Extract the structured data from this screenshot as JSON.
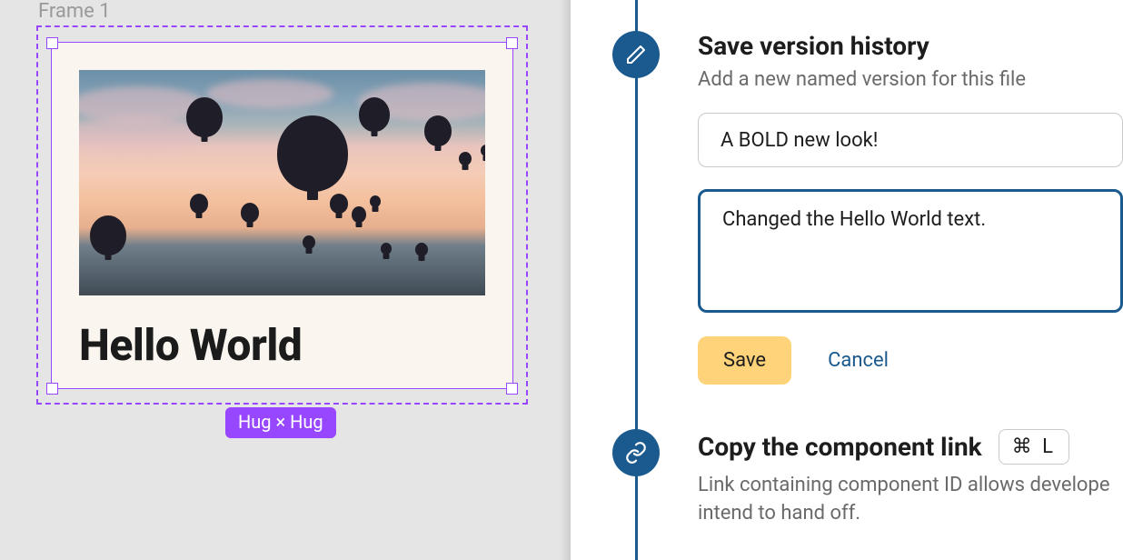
{
  "canvas": {
    "frame_label": "Frame 1",
    "card_title": "Hello World",
    "size_badge": "Hug × Hug"
  },
  "step1": {
    "title": "Save version history",
    "subtitle": "Add a new named version for this file",
    "name_value": "A BOLD new look!",
    "desc_value": "Changed the Hello World text.",
    "save_label": "Save",
    "cancel_label": "Cancel"
  },
  "step2": {
    "title": "Copy the component link",
    "shortcut": "⌘ L",
    "subtitle": "Link containing component ID allows develope intend to hand off."
  }
}
